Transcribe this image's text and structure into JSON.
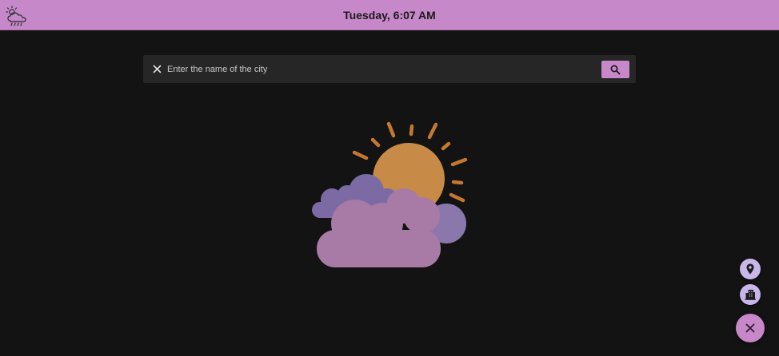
{
  "app": {
    "icon": "weather-rain-cloud-icon",
    "title": "Tuesday, 6:07 AM"
  },
  "search": {
    "placeholder": "Enter the name of the city",
    "value": "",
    "clear_icon": "close-icon",
    "submit_icon": "search-icon"
  },
  "illustration": {
    "icon": "sun-behind-clouds-icon"
  },
  "fabs": [
    {
      "icon": "location-pin-icon"
    },
    {
      "icon": "city-building-icon"
    },
    {
      "icon": "close-icon"
    }
  ],
  "colors": {
    "accent": "#c688c9",
    "fab_secondary": "#c9b6ea",
    "background": "#131313",
    "search_background": "#262626",
    "sun": "#c88a47",
    "cloud_front": "#a87aa6",
    "cloud_back": "#7b6aa3"
  }
}
